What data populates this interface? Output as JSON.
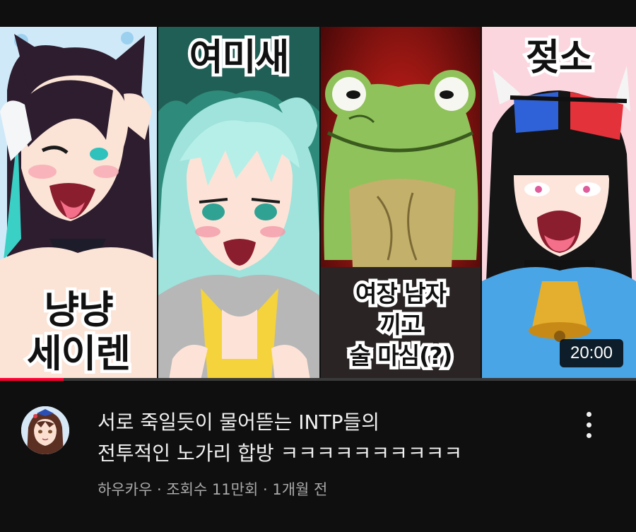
{
  "video": {
    "thumbnail": {
      "panels": [
        {
          "caption_top": "",
          "caption_bottom_line1": "냥냥",
          "caption_bottom_line2": "세이렌"
        },
        {
          "caption_top": "여미새",
          "caption_bottom_line1": "",
          "caption_bottom_line2": ""
        },
        {
          "caption_top": "",
          "caption_bottom_line1": "여장 남자",
          "caption_bottom_line2": "끼고",
          "caption_bottom_line3": "술 마심(?)"
        },
        {
          "caption_top": "젖소",
          "caption_bottom_line1": "",
          "caption_bottom_line2": ""
        }
      ],
      "duration": "20:00",
      "watch_progress": 0.1
    },
    "title_line1": "서로 죽일듯이 물어뜯는 INTP들의",
    "title_line2": "전투적인 노가리 합방 ㅋㅋㅋㅋㅋㅋㅋㅋㅋㅋ",
    "channel_name": "하우카우",
    "separator": " · ",
    "views": "조회수 11만회",
    "age": "1개월 전",
    "avatar_icon": "channel-avatar-anime-girl",
    "menu_icon": "more-vertical-icon"
  },
  "colors": {
    "background": "#0f0f0f",
    "title": "#f1f1f1",
    "meta": "#aaaaaa",
    "progress": "#ff0033"
  }
}
